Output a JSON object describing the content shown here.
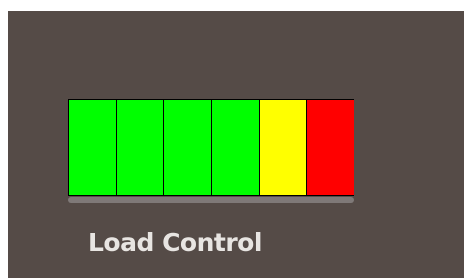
{
  "panel": {
    "background": "#554b47"
  },
  "load_meter": {
    "segment_count": 6,
    "segment_colors": [
      "#00ff00",
      "#00ff00",
      "#00ff00",
      "#00ff00",
      "#ffff00",
      "#ff0000"
    ],
    "segments": [
      {
        "state": "green"
      },
      {
        "state": "green"
      },
      {
        "state": "green"
      },
      {
        "state": "green"
      },
      {
        "state": "yellow"
      },
      {
        "state": "red"
      }
    ]
  },
  "label": "Load Control"
}
